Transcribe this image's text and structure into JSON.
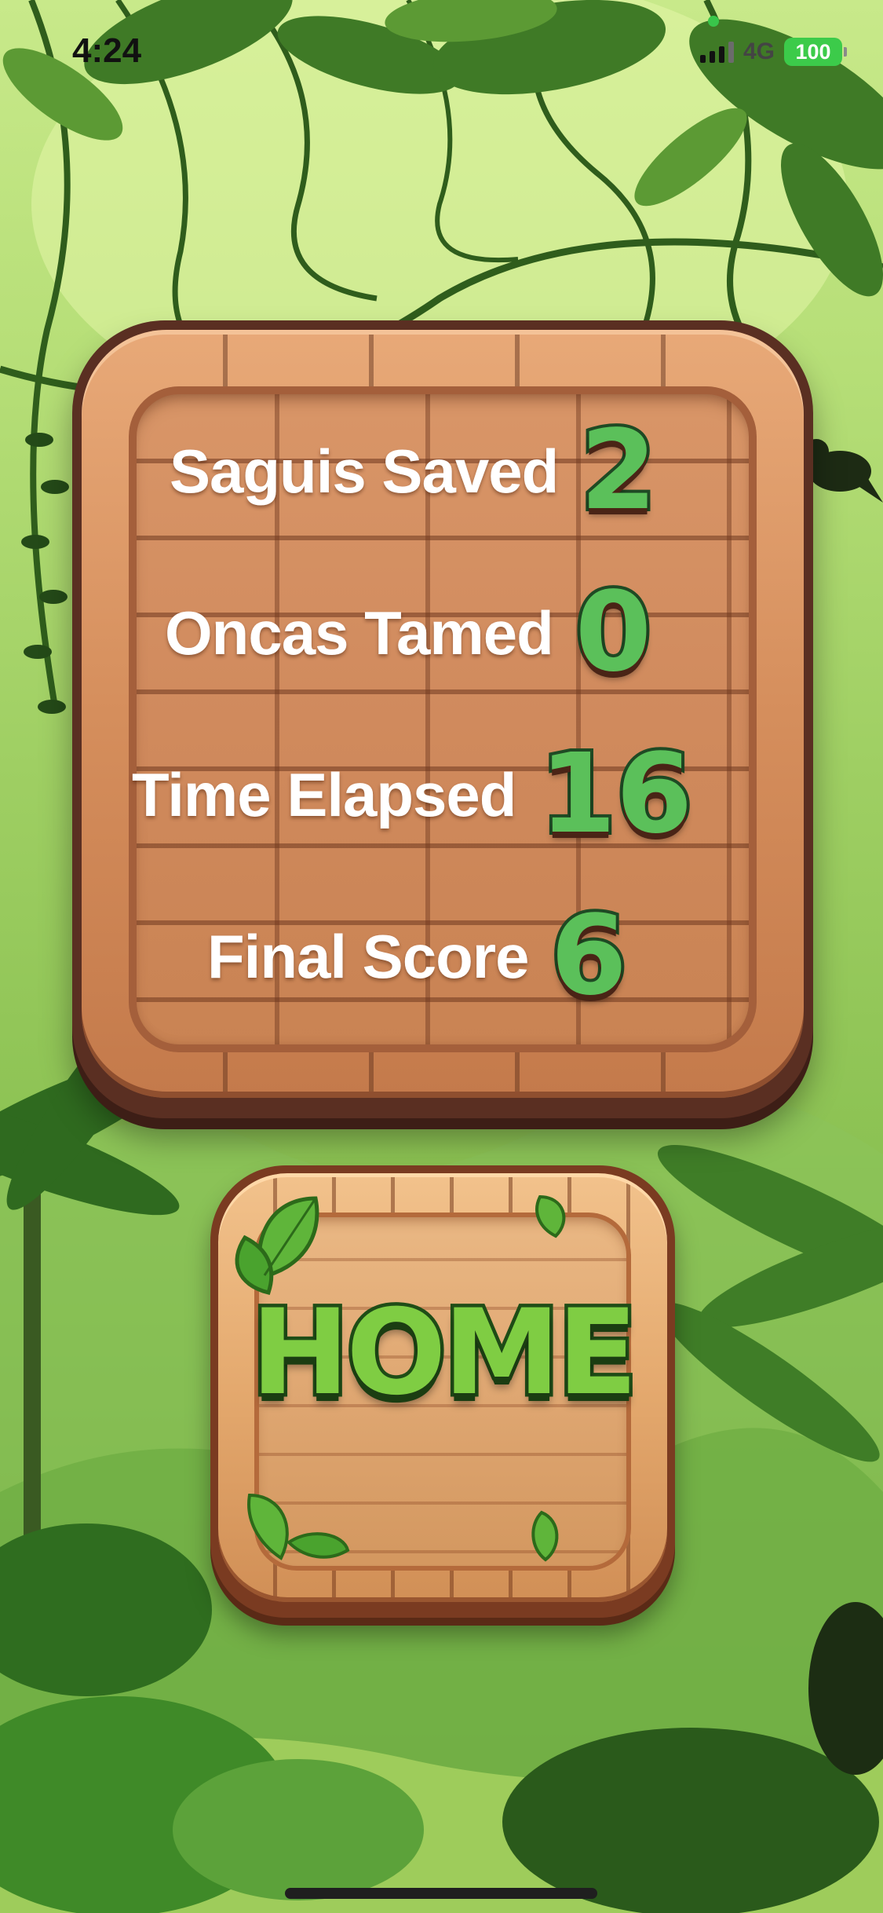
{
  "status_bar": {
    "time": "4:24",
    "network": "4G",
    "battery": "100",
    "icons": [
      "signal-icon",
      "battery-icon"
    ]
  },
  "results": {
    "stats": [
      {
        "label": "Saguis Saved",
        "value": "2"
      },
      {
        "label": "Oncas Tamed",
        "value": "0"
      },
      {
        "label": "Time Elapsed",
        "value": "16"
      },
      {
        "label": "Final Score",
        "value": "6"
      }
    ]
  },
  "home_button": {
    "label": "HOME",
    "icon": "leaf-icon"
  },
  "colors": {
    "wood": "#d08a5d",
    "wood_dark": "#5a2f22",
    "number_green": "#5bc05a",
    "home_green": "#7fcd43",
    "jungle_light": "#c8e98a",
    "jungle_dark": "#4c8a2a"
  }
}
